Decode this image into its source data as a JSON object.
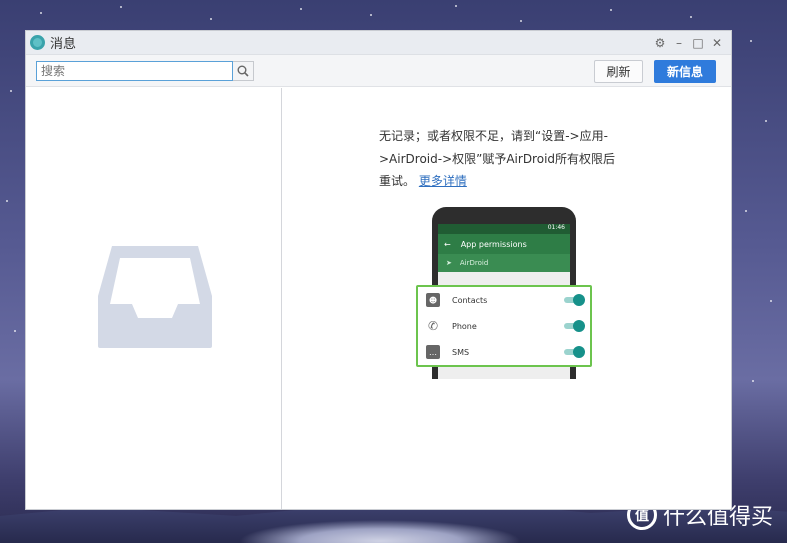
{
  "window": {
    "title": "消息"
  },
  "toolbar": {
    "search_placeholder": "搜索",
    "refresh_label": "刷新",
    "new_message_label": "新信息"
  },
  "message": {
    "text": "无记录；或者权限不足，请到“设置->应用->AirDroid->权限”赋予AirDroid所有权限后重试。",
    "link": "更多详情"
  },
  "illustration": {
    "appbar_title": "App permissions",
    "app_name": "AirDroid",
    "status_time": "01:46",
    "permissions": [
      {
        "label": "Contacts",
        "icon": "contacts-icon",
        "enabled": true
      },
      {
        "label": "Phone",
        "icon": "phone-icon",
        "enabled": true
      },
      {
        "label": "SMS",
        "icon": "sms-icon",
        "enabled": true
      }
    ]
  },
  "watermark": {
    "text": "什么值得买",
    "logo": "值"
  },
  "colors": {
    "primary_button": "#2f7bdc",
    "link": "#2f6fbf",
    "app_green": "#2e7d46",
    "highlight_border": "#6cc44e",
    "toggle_on": "#16918a"
  }
}
